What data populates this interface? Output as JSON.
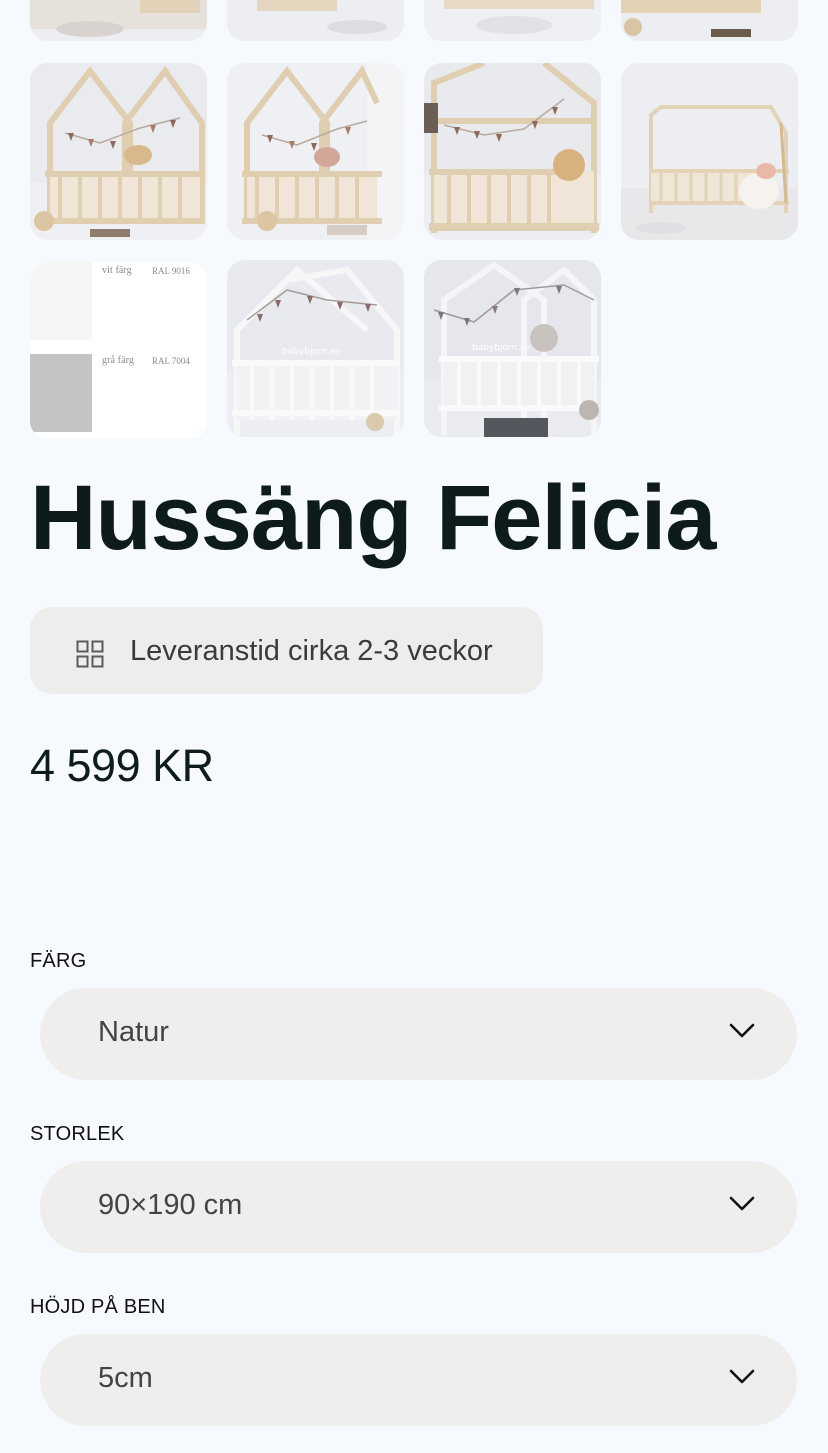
{
  "gallery": {
    "swatches": [
      {
        "label": "vit färg",
        "code": "RAL 9016",
        "color": "#f7f6f4"
      },
      {
        "label": "grå färg",
        "code": "RAL 7004",
        "color": "#c3c4c5"
      }
    ],
    "watermark": "babybjorn.se"
  },
  "product": {
    "title": "Hussäng Felicia",
    "delivery": "Leveranstid cirka 2-3 veckor",
    "price": "4 599 KR"
  },
  "options": [
    {
      "label": "FÄRG",
      "value": "Natur"
    },
    {
      "label": "STORLEK",
      "value": "90×190 cm"
    },
    {
      "label": "HÖJD PÅ BEN",
      "value": "5cm"
    }
  ],
  "colors": {
    "background": "#f6f9fd",
    "pill": "#eeedeb",
    "wood": "#e3d3b8",
    "text": "#0f1c1e"
  },
  "icons": [
    "grid-icon",
    "chevron-down-icon"
  ]
}
